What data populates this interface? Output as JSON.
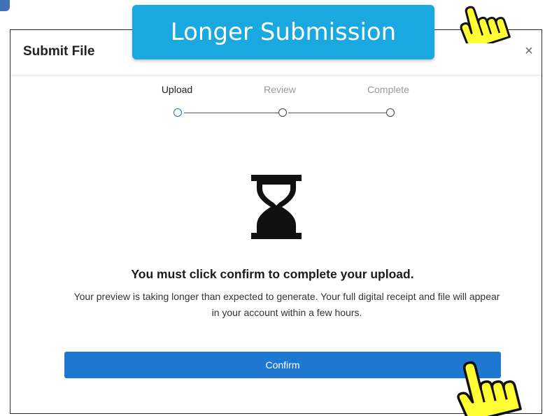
{
  "banner": {
    "text": "Longer Submission"
  },
  "dialog": {
    "title": "Submit File",
    "close_label": "×"
  },
  "steps": [
    {
      "label": "Upload",
      "state": "active"
    },
    {
      "label": "Review",
      "state": "inactive"
    },
    {
      "label": "Complete",
      "state": "inactive"
    }
  ],
  "status": {
    "icon": "hourglass-icon",
    "heading": "You must click confirm to complete your upload.",
    "body": "Your preview is taking longer than expected to generate. Your full digital receipt and file will appear in your account within a few hours."
  },
  "actions": {
    "confirm_label": "Confirm"
  },
  "colors": {
    "banner": "#1aa8e0",
    "primary": "#1e78d2",
    "active_step": "#1d6fb8",
    "cursor_fill": "#ffff33"
  }
}
